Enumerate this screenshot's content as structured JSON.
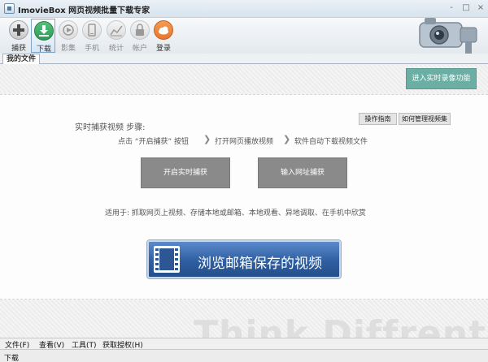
{
  "window": {
    "title": "ImovieBox 网页视频批量下载专家",
    "minimize": "-",
    "maximize": "□",
    "close": "×"
  },
  "toolbar": [
    {
      "label": "捕获",
      "icon": "plus-icon",
      "state": "normal"
    },
    {
      "label": "下载",
      "icon": "download-icon",
      "state": "active"
    },
    {
      "label": "影集",
      "icon": "play-icon",
      "state": "disabled"
    },
    {
      "label": "手机",
      "icon": "phone-icon",
      "state": "disabled"
    },
    {
      "label": "统计",
      "icon": "chart-icon",
      "state": "disabled"
    },
    {
      "label": "帐户",
      "icon": "lock-icon",
      "state": "disabled"
    },
    {
      "label": "登录",
      "icon": "cloud-icon",
      "state": "normal"
    }
  ],
  "tabs": {
    "my_files": "我的文件"
  },
  "realtime_button": "进入实时录像功能",
  "guide_buttons": {
    "guide": "操作指南",
    "manage": "如何管理视频集"
  },
  "steps": {
    "title": "实时捕获视频 步骤:",
    "step1": "点击 “开启捕获” 按钮",
    "step2": "打开网页播放视频",
    "step3": "软件自动下载视频文件"
  },
  "actions": {
    "start_capture": "开启实时捕获",
    "enter_url": "输入网址捕获"
  },
  "usage": "适用于: 抓取网页上视频、存储本地或邮箱、本地观看、异地调取、在手机中欣赏",
  "browse_button": "浏览邮箱保存的视频",
  "watermark": "Think Diffrent",
  "menu": {
    "file": "文件(F)",
    "view": "查看(V)",
    "tools": "工具(T)",
    "license": "获取授权(H)"
  },
  "status": "下载",
  "colors": {
    "teal_button": "#6aaea4",
    "gray_button": "#8a8a8a",
    "blue_button": "#2f5fa0",
    "download_icon": "#2f9a55",
    "cloud_icon": "#e8782c"
  }
}
